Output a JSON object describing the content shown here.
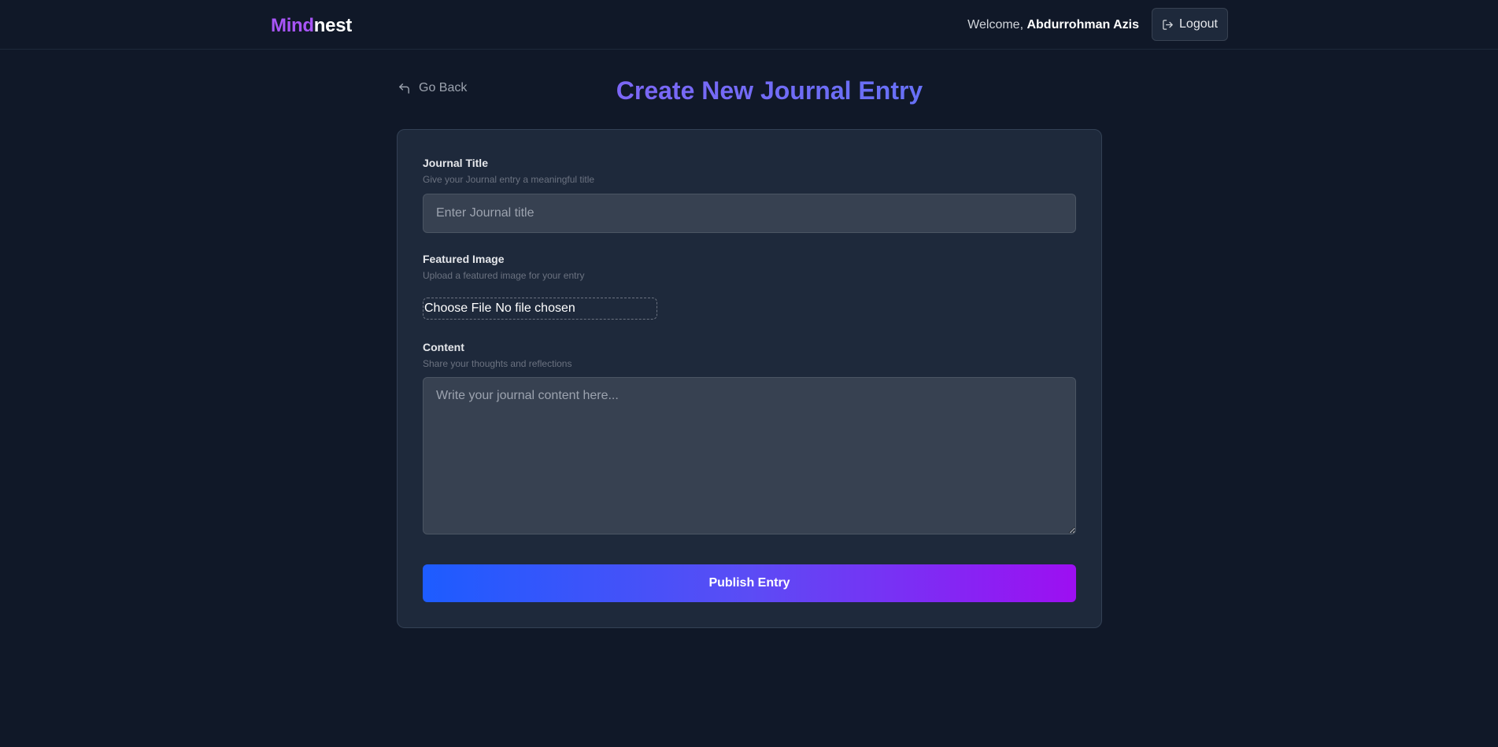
{
  "header": {
    "logo_part1": "Mind",
    "logo_part2": "nest",
    "welcome_prefix": "Welcome,",
    "username": "Abdurrohman Azis",
    "logout_label": "Logout"
  },
  "nav": {
    "back_label": "Go Back"
  },
  "page": {
    "title": "Create New Journal Entry"
  },
  "form": {
    "title_field": {
      "label": "Journal Title",
      "help": "Give your Journal entry a meaningful title",
      "placeholder": "Enter Journal title",
      "value": ""
    },
    "image_field": {
      "label": "Featured Image",
      "help": "Upload a featured image for your entry",
      "button_label": "Choose File",
      "status": "No file chosen"
    },
    "content_field": {
      "label": "Content",
      "help": "Share your thoughts and reflections",
      "placeholder": "Write your journal content here...",
      "value": ""
    },
    "submit_label": "Publish Entry"
  },
  "colors": {
    "background": "#101828",
    "card": "#1e293b",
    "accent_purple": "#a855f7",
    "accent_blue": "#3b82f6"
  },
  "icons": {
    "logout": "logout-icon",
    "back": "return-arrow-icon"
  }
}
